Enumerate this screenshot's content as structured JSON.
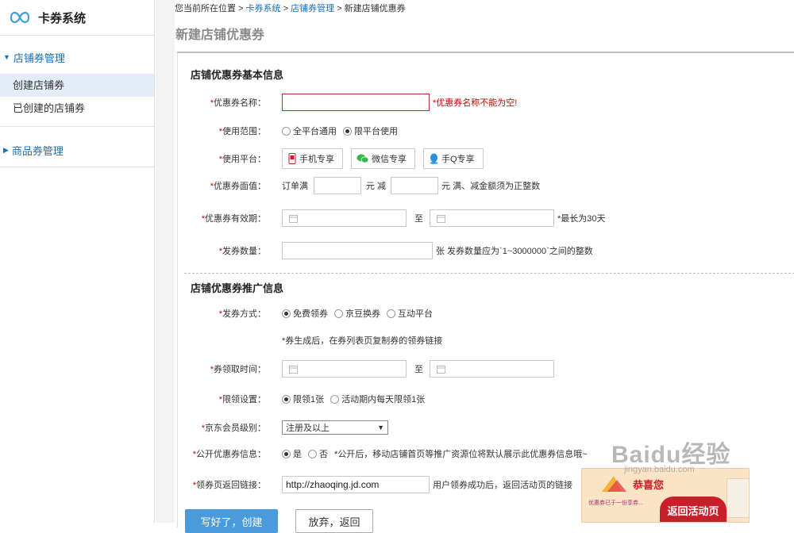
{
  "app": {
    "logo_text": "卡券系统"
  },
  "sidebar": {
    "groups": [
      {
        "label": "店铺券管理",
        "items": [
          {
            "label": "创建店铺券"
          },
          {
            "label": "已创建的店铺券"
          }
        ]
      },
      {
        "label": "商品券管理"
      }
    ]
  },
  "breadcrumb": {
    "prefix": "您当前所在位置",
    "sep": ">",
    "l1": "卡券系统",
    "l2": "店铺券管理",
    "current": "新建店铺优惠券"
  },
  "page_title": "新建店铺优惠券",
  "section1": {
    "title": "店铺优惠券基本信息"
  },
  "section2": {
    "title": "店铺优惠券推广信息"
  },
  "form": {
    "name": {
      "label": "优惠券名称：",
      "value": "",
      "error": "*优惠券名称不能为空!"
    },
    "scope": {
      "label": "使用范围：",
      "options": [
        "全平台通用",
        "限平台使用"
      ],
      "selected": 1
    },
    "platform": {
      "label": "使用平台：",
      "buttons": [
        "手机专享",
        "微信专享",
        "手Q专享"
      ]
    },
    "face": {
      "label": "优惠券面值：",
      "prefix": "订单满",
      "unit1": "元 减",
      "unit2": "元 满、减金额须为正整数"
    },
    "valid": {
      "label": "优惠券有效期：",
      "to": "至",
      "hint": "*最长为30天"
    },
    "qty": {
      "label": "发券数量：",
      "hint": "张 发券数量应为`1~3000000`之间的整数"
    },
    "method": {
      "label": "发券方式：",
      "options": [
        "免费领券",
        "京豆换券",
        "互动平台"
      ],
      "selected": 0,
      "note": "*券生成后，在券列表页复制券的领券链接"
    },
    "claim_time": {
      "label": "券领取时间：",
      "to": "至"
    },
    "limit": {
      "label": "限领设置：",
      "options": [
        "限领1张",
        "活动期内每天限领1张"
      ],
      "selected": 0
    },
    "level": {
      "label": "京东会员级别：",
      "value": "注册及以上"
    },
    "public": {
      "label": "公开优惠券信息：",
      "options": [
        "是",
        "否"
      ],
      "selected": 0,
      "hint": "*公开后，移动店铺首页等推广资源位将默认展示此优惠券信息哦~"
    },
    "return_link": {
      "label": "领券页返回链接：",
      "value": "http://zhaoqing.jd.com",
      "hint": "用户领券成功后，返回活动页的链接"
    }
  },
  "actions": {
    "create": "写好了，创建",
    "cancel": "放弃，返回"
  },
  "promo": {
    "congrats": "恭喜您",
    "tiny": "优惠券已于一份享券...",
    "return": "返回活动页"
  },
  "watermark": {
    "text": "Baidu经验",
    "sub": "jingyan.baidu.com"
  },
  "colors": {
    "link": "#1a6fb6",
    "primary": "#4a9bdb",
    "error": "#cc0000",
    "active_bg": "#e3edf7"
  }
}
